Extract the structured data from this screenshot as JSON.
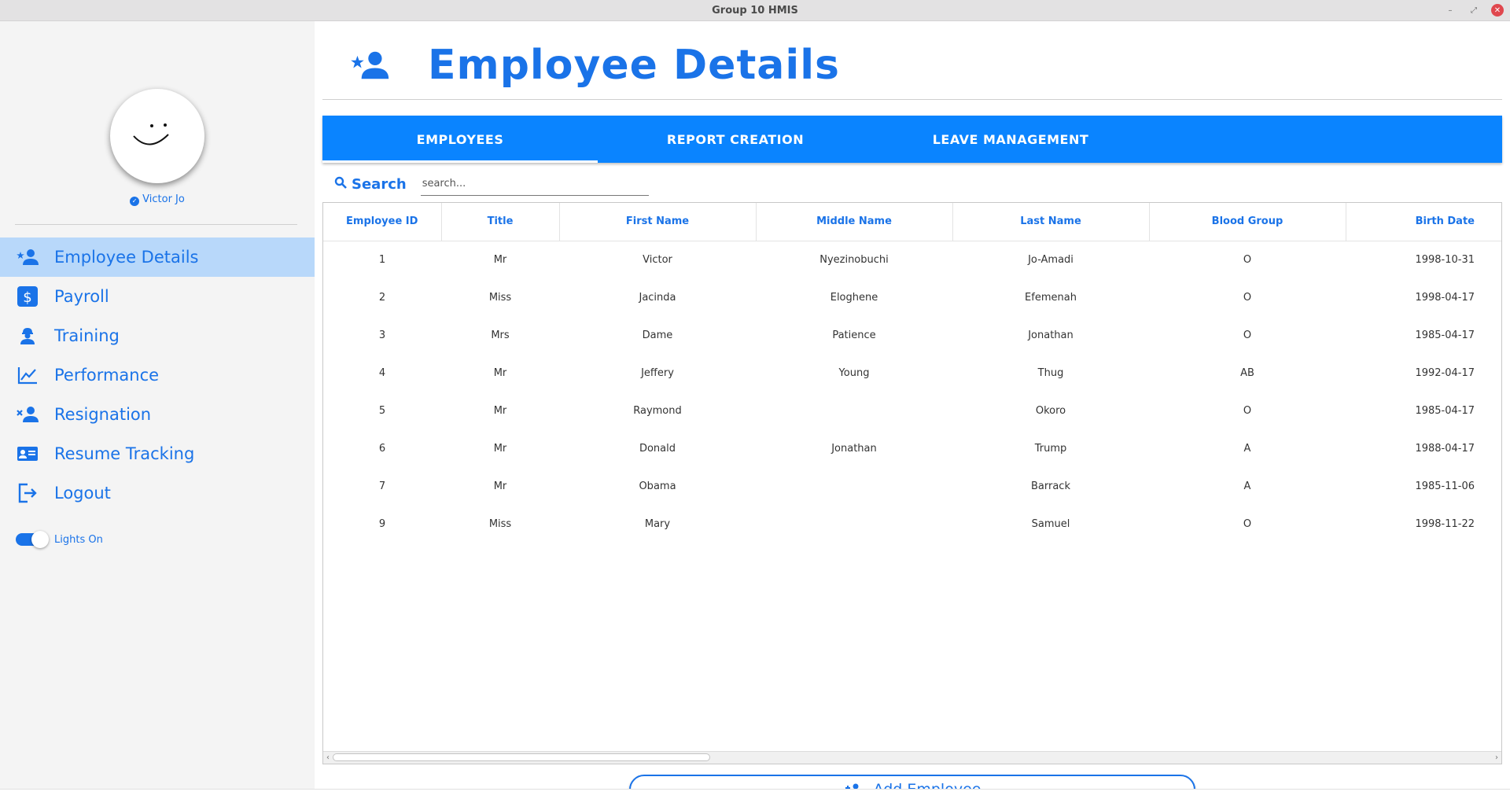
{
  "window": {
    "title": "Group 10 HMIS"
  },
  "sidebar": {
    "user_name": "Victor Jo",
    "items": [
      {
        "label": "Employee Details",
        "icon": "person-star-icon",
        "active": true
      },
      {
        "label": "Payroll",
        "icon": "dollar-icon"
      },
      {
        "label": "Training",
        "icon": "worker-icon"
      },
      {
        "label": "Performance",
        "icon": "chart-line-icon"
      },
      {
        "label": "Resignation",
        "icon": "person-remove-icon"
      },
      {
        "label": "Resume Tracking",
        "icon": "id-card-icon"
      },
      {
        "label": "Logout",
        "icon": "logout-icon"
      }
    ],
    "toggle_label": "Lights On",
    "toggle_on": true
  },
  "header": {
    "title": "Employee Details",
    "icon": "person-star-icon"
  },
  "tabs": [
    {
      "label": "EMPLOYEES",
      "active": true
    },
    {
      "label": "REPORT CREATION"
    },
    {
      "label": "LEAVE MANAGEMENT"
    }
  ],
  "search": {
    "label": "Search",
    "placeholder": "search..."
  },
  "table": {
    "columns": [
      "Employee ID",
      "Title",
      "First Name",
      "Middle Name",
      "Last Name",
      "Blood Group",
      "Birth Date"
    ],
    "rows": [
      [
        "1",
        "Mr",
        "Victor",
        "Nyezinobuchi",
        "Jo-Amadi",
        "O",
        "1998-10-31"
      ],
      [
        "2",
        "Miss",
        "Jacinda",
        "Eloghene",
        "Efemenah",
        "O",
        "1998-04-17"
      ],
      [
        "3",
        "Mrs",
        "Dame",
        "Patience",
        "Jonathan",
        "O",
        "1985-04-17"
      ],
      [
        "4",
        "Mr",
        "Jeffery",
        "Young",
        "Thug",
        "AB",
        "1992-04-17"
      ],
      [
        "5",
        "Mr",
        "Raymond",
        "",
        "Okoro",
        "O",
        "1985-04-17"
      ],
      [
        "6",
        "Mr",
        "Donald",
        "Jonathan",
        "Trump",
        "A",
        "1988-04-17"
      ],
      [
        "7",
        "Mr",
        "Obama",
        "",
        "Barrack",
        "A",
        "1985-11-06"
      ],
      [
        "9",
        "Miss",
        "Mary",
        "",
        "Samuel",
        "O",
        "1998-11-22"
      ]
    ]
  },
  "actions": {
    "add_label": "Add Employee"
  },
  "colors": {
    "accent": "#1a73e8",
    "tab_bar": "#0a84ff",
    "active_nav": "#b8d8fa",
    "sidebar_bg": "#f4f4f4"
  }
}
